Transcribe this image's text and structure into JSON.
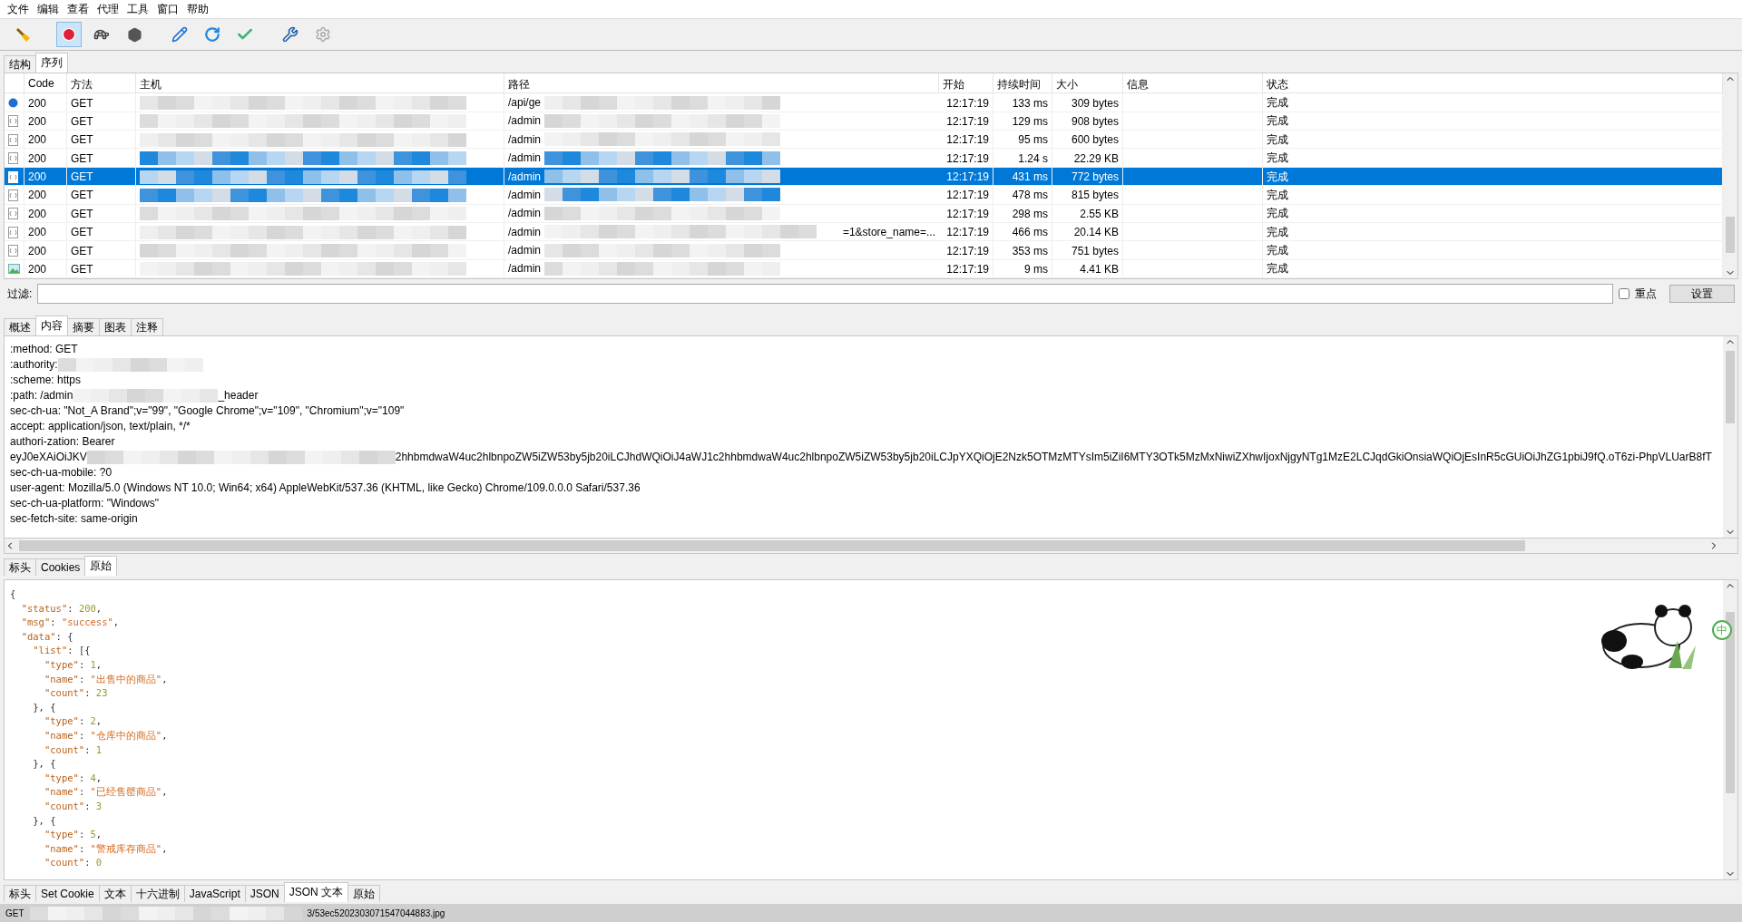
{
  "menu": [
    "文件",
    "编辑",
    "查看",
    "代理",
    "工具",
    "窗口",
    "帮助"
  ],
  "toolbar": [
    {
      "kind": "broom",
      "selected": false
    },
    {
      "kind": "record",
      "selected": true
    },
    {
      "kind": "turtle",
      "selected": false
    },
    {
      "kind": "stop",
      "selected": false
    },
    {
      "kind": "pen",
      "selected": false
    },
    {
      "kind": "refresh",
      "selected": false
    },
    {
      "kind": "check",
      "selected": false
    },
    {
      "kind": "tools",
      "selected": false
    },
    {
      "kind": "gear",
      "selected": false
    }
  ],
  "view_tabs": [
    {
      "label": "结构",
      "selected": false
    },
    {
      "label": "序列",
      "selected": true
    }
  ],
  "table": {
    "columns": [
      "Code",
      "方法",
      "主机",
      "路径",
      "开始",
      "持续时间",
      "大小",
      "信息",
      "状态"
    ],
    "rows": [
      {
        "kind": "loading",
        "selected": false,
        "code": "200",
        "method": "GET",
        "path": "/api/ge",
        "start": "12:17:19",
        "duration": "133 ms",
        "size": "309 bytes",
        "status": "完成"
      },
      {
        "kind": "json",
        "selected": false,
        "code": "200",
        "method": "GET",
        "path": "/admin",
        "start": "12:17:19",
        "duration": "129 ms",
        "size": "908 bytes",
        "status": "完成"
      },
      {
        "kind": "json",
        "selected": false,
        "code": "200",
        "method": "GET",
        "path": "/admin",
        "start": "12:17:19",
        "duration": "95 ms",
        "size": "600 bytes",
        "status": "完成"
      },
      {
        "kind": "json",
        "selected": false,
        "code": "200",
        "method": "GET",
        "path": "/admin",
        "start": "12:17:19",
        "duration": "1.24 s",
        "size": "22.29 KB",
        "status": "完成"
      },
      {
        "kind": "json",
        "selected": true,
        "code": "200",
        "method": "GET",
        "path": "/admin",
        "start": "12:17:19",
        "duration": "431 ms",
        "size": "772 bytes",
        "status": "完成"
      },
      {
        "kind": "json",
        "selected": false,
        "code": "200",
        "method": "GET",
        "path": "/admin",
        "start": "12:17:19",
        "duration": "478 ms",
        "size": "815 bytes",
        "status": "完成"
      },
      {
        "kind": "json",
        "selected": false,
        "code": "200",
        "method": "GET",
        "path": "/admin",
        "start": "12:17:19",
        "duration": "298 ms",
        "size": "2.55 KB",
        "status": "完成"
      },
      {
        "kind": "json",
        "selected": false,
        "code": "200",
        "method": "GET",
        "path": "/admin",
        "path_tail": "=1&store_name=...",
        "start": "12:17:19",
        "duration": "466 ms",
        "size": "20.14 KB",
        "status": "完成"
      },
      {
        "kind": "json",
        "selected": false,
        "code": "200",
        "method": "GET",
        "path": "/admin",
        "start": "12:17:19",
        "duration": "353 ms",
        "size": "751 bytes",
        "status": "完成"
      },
      {
        "kind": "image",
        "selected": false,
        "code": "200",
        "method": "GET",
        "path": "/admin",
        "start": "12:17:19",
        "duration": "9 ms",
        "size": "4.41 KB",
        "status": "完成"
      }
    ]
  },
  "filter": {
    "label": "过滤:",
    "focus_label": "重点",
    "focus_checked": false,
    "button": "设置"
  },
  "detail_tabs": [
    {
      "label": "概述",
      "selected": false
    },
    {
      "label": "内容",
      "selected": true
    },
    {
      "label": "摘要",
      "selected": false
    },
    {
      "label": "图表",
      "selected": false
    },
    {
      "label": "注释",
      "selected": false
    }
  ],
  "request_lines": [
    {
      "parts": [
        ":method: GET"
      ]
    },
    {
      "parts": [
        ":authority:"
      ],
      "redacted": true
    },
    {
      "parts": [
        ":scheme: https"
      ]
    },
    {
      "parts": [
        ":path: /admin",
        "_header"
      ]
    },
    {
      "parts": [
        "sec-ch-ua: \"Not_A Brand\";v=\"99\", \"Google Chrome\";v=\"109\", \"Chromium\";v=\"109\""
      ]
    },
    {
      "parts": [
        "accept: application/json, text/plain, */*"
      ]
    },
    {
      "parts": [
        "authori-zation: Bearer"
      ]
    },
    {
      "parts": [
        "eyJ0eXAiOiJKV",
        "2hhbmdwaW4uc2hlbnpoZW5iZW53by5jb20iLCJhdWQiOiJ4aWJ1c2hhbmdwaW4uc2hlbnpoZW5iZW53by5jb20iLCJpYXQiOjE2Nzk5OTMzMTYsIm5iZiI6MTY3OTk5MzMxNiwiZXhwIjoxNjgyNTg1MzE2LCJqdGkiOnsiaWQiOjEsInR5cGUiOiJhZG1pbiJ9fQ.oT6zi-PhpVLUarB8fT"
      ]
    },
    {
      "parts": [
        "sec-ch-ua-mobile: ?0"
      ]
    },
    {
      "parts": [
        "user-agent: Mozilla/5.0 (Windows NT 10.0; Win64; x64) AppleWebKit/537.36 (KHTML, like Gecko) Chrome/109.0.0.0 Safari/537.36"
      ]
    },
    {
      "parts": [
        "sec-ch-ua-platform: \"Windows\""
      ]
    },
    {
      "parts": [
        "sec-fetch-site: same-origin"
      ]
    }
  ],
  "request_tabs": [
    {
      "label": "标头",
      "selected": false
    },
    {
      "label": "Cookies",
      "selected": false
    },
    {
      "label": "原始",
      "selected": true
    }
  ],
  "json_lines": [
    "{",
    "  \"status\": 200,",
    "  \"msg\": \"success\",",
    "  \"data\": {",
    "    \"list\": [{",
    "      \"type\": 1,",
    "      \"name\": \"出售中的商品\",",
    "      \"count\": 23",
    "    }, {",
    "      \"type\": 2,",
    "      \"name\": \"仓库中的商品\",",
    "      \"count\": 1",
    "    }, {",
    "      \"type\": 4,",
    "      \"name\": \"已经售罄商品\",",
    "      \"count\": 3",
    "    }, {",
    "      \"type\": 5,",
    "      \"name\": \"警戒库存商品\",",
    "      \"count\": 0"
  ],
  "ime_indicator": "中",
  "response_tabs": [
    {
      "label": "标头",
      "selected": false
    },
    {
      "label": "Set Cookie",
      "selected": false
    },
    {
      "label": "文本",
      "selected": false
    },
    {
      "label": "十六进制",
      "selected": false
    },
    {
      "label": "JavaScript",
      "selected": false
    },
    {
      "label": "JSON",
      "selected": false
    },
    {
      "label": "JSON 文本",
      "selected": true
    },
    {
      "label": "原始",
      "selected": false
    }
  ],
  "status_bar": {
    "method": "GET",
    "path_tail": "3/53ec5202303071547044883.jpg"
  }
}
